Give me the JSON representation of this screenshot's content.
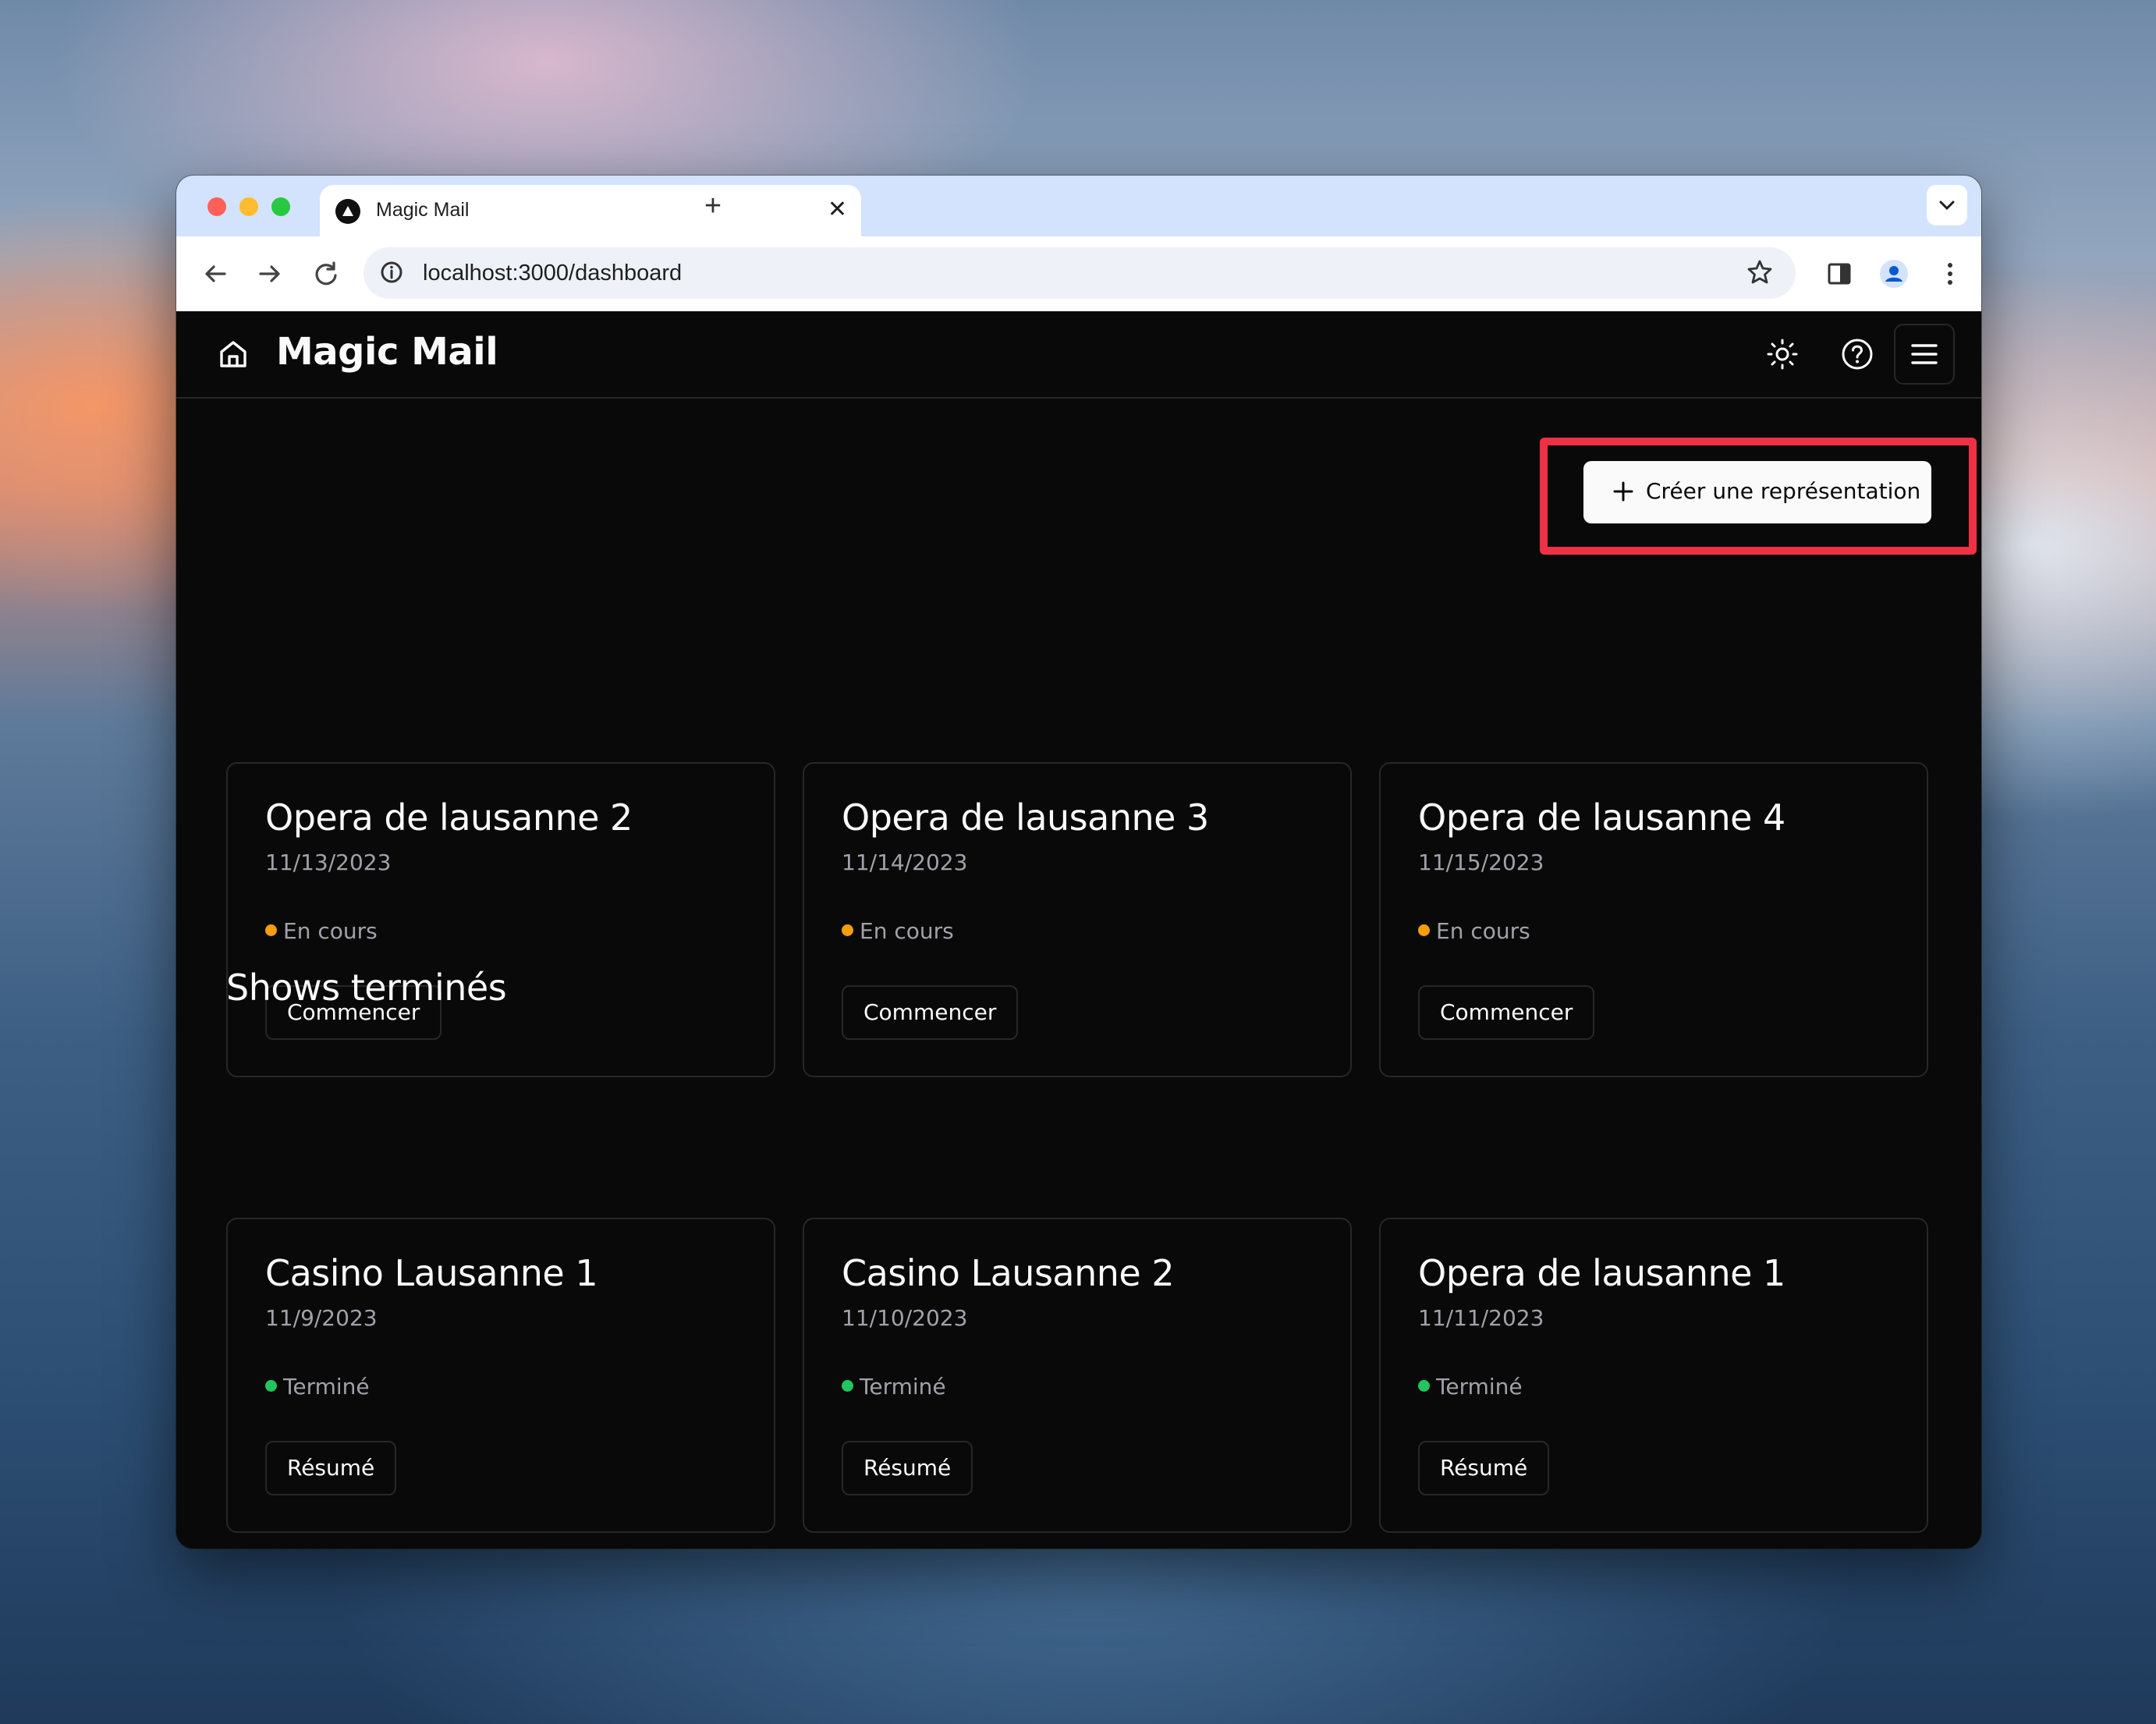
{
  "browser": {
    "tab_title": "Magic Mail",
    "tab_close": "✕",
    "new_tab": "+",
    "url": "localhost:3000/dashboard"
  },
  "app": {
    "title": "Magic Mail",
    "create_button_label": "Créer une représentation",
    "create_button_icon": "+",
    "highlight_color": "#ef3145",
    "accent_in_progress": "#f59e0b",
    "accent_done": "#22c55e"
  },
  "upcoming": [
    {
      "title": "Opera de lausanne 2",
      "date": "11/13/2023",
      "status": "En cours",
      "action": "Commencer"
    },
    {
      "title": "Opera de lausanne 3",
      "date": "11/14/2023",
      "status": "En cours",
      "action": "Commencer"
    },
    {
      "title": "Opera de lausanne 4",
      "date": "11/15/2023",
      "status": "En cours",
      "action": "Commencer"
    }
  ],
  "finished_section_title": "Shows terminés",
  "finished": [
    {
      "title": "Casino Lausanne 1",
      "date": "11/9/2023",
      "status": "Terminé",
      "action": "Résumé"
    },
    {
      "title": "Casino Lausanne 2",
      "date": "11/10/2023",
      "status": "Terminé",
      "action": "Résumé"
    },
    {
      "title": "Opera de lausanne 1",
      "date": "11/11/2023",
      "status": "Terminé",
      "action": "Résumé"
    }
  ]
}
